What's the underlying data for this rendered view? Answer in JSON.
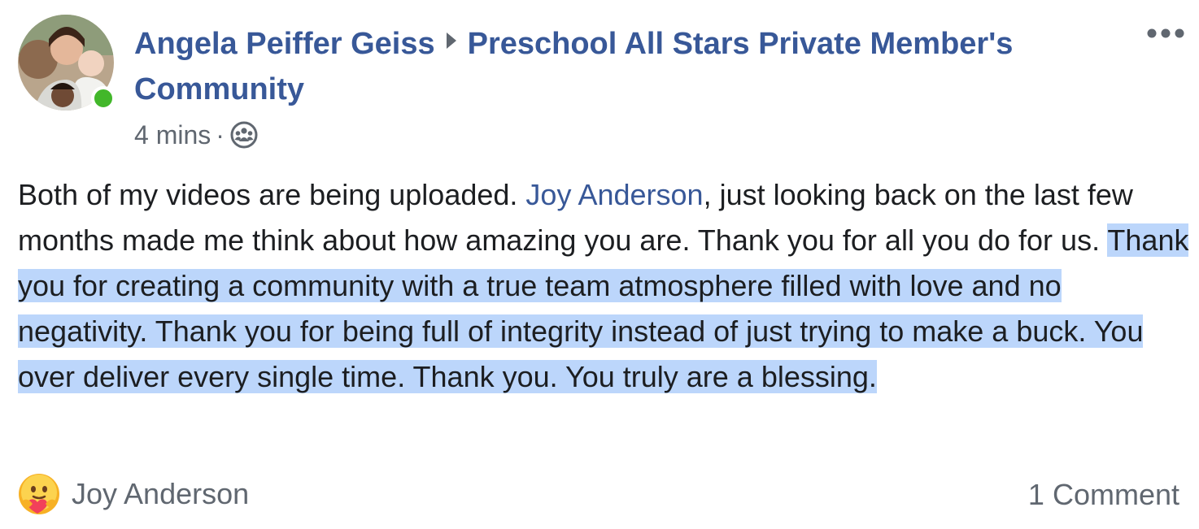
{
  "post": {
    "author": "Angela Peiffer Geiss",
    "group": "Preschool All Stars Private Member's Community",
    "timestamp": "4 mins",
    "separator": "·",
    "privacy_icon": "group-icon",
    "more_icon": "more-options-icon",
    "body": {
      "part1": "Both of my videos are being uploaded. ",
      "mention": "Joy Anderson",
      "part2": ", just looking back on the last few months made me think about how amazing you are. Thank you for all you do for us. ",
      "highlighted": "Thank you for creating a community with a true team atmosphere filled with love and no negativity. Thank you for being full of integrity instead of just trying to make a buck. You over deliver every single time. Thank you. You truly are a blessing."
    },
    "reactions": {
      "icon": "care-reaction-icon",
      "names": "Joy Anderson"
    },
    "comments": "1 Comment"
  },
  "colors": {
    "link": "#385898",
    "secondary_text": "#606770",
    "body_text": "#1c1e21",
    "highlight": "#bcd6fb",
    "online": "#42b72a"
  }
}
